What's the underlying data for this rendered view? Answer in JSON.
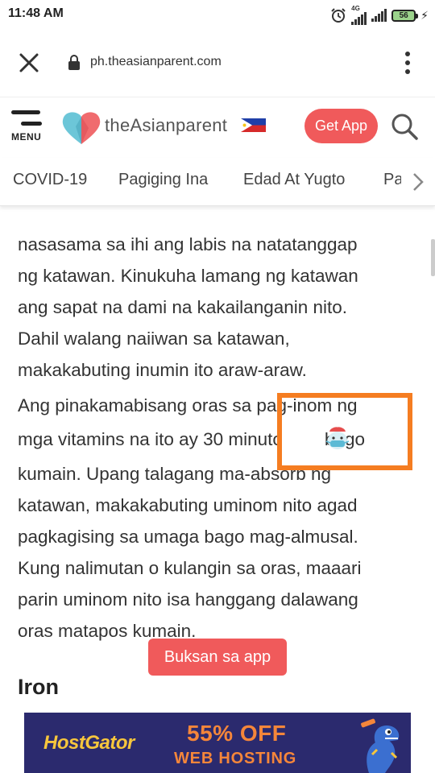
{
  "status_bar": {
    "time": "11:48 AM",
    "network_label": "4G",
    "battery": "56"
  },
  "url_bar": {
    "url": "ph.theasianparent.com"
  },
  "site_header": {
    "menu_label": "MENU",
    "logo_text": "theAsianparent",
    "get_app_label": "Get App"
  },
  "category_tabs": [
    "COVID-19",
    "Pagiging Ina",
    "Edad At Yugto",
    "Pag"
  ],
  "article": {
    "paragraph1_lines": [
      "nasasama sa ihi ang labis na natatanggap",
      "ng katawan. Kinukuha lamang ng katawan",
      "ang sapat na dami na kakailanganin nito.",
      "Dahil walang naiiwan sa katawan,",
      "makakabuting inumin ito araw-araw."
    ],
    "paragraph2_lines": [
      "Ang pinakamabisang oras sa pag-inom ng",
      "mga vitamins na ito ay 30 minuto",
      "kumain. Upang talagang ma-absorb ng",
      "katawan, makakabuting uminom nito agad",
      "pagkagising sa umaga bago mag-almusal.",
      "Kung nalimutan o kulangin sa oras, maaari",
      "parin uminom nito isa hanggang dalawang",
      "oras matapos kumain."
    ],
    "line2_tail": "bago",
    "heading": "Iron"
  },
  "open_app_button": "Buksan sa app",
  "ad": {
    "brand": "HostGator",
    "offer": "55% OFF",
    "subtitle": "WEB HOSTING"
  },
  "colors": {
    "accent": "#f05a5b",
    "highlight": "#f57d21",
    "ad_background": "#2b2a6e"
  }
}
